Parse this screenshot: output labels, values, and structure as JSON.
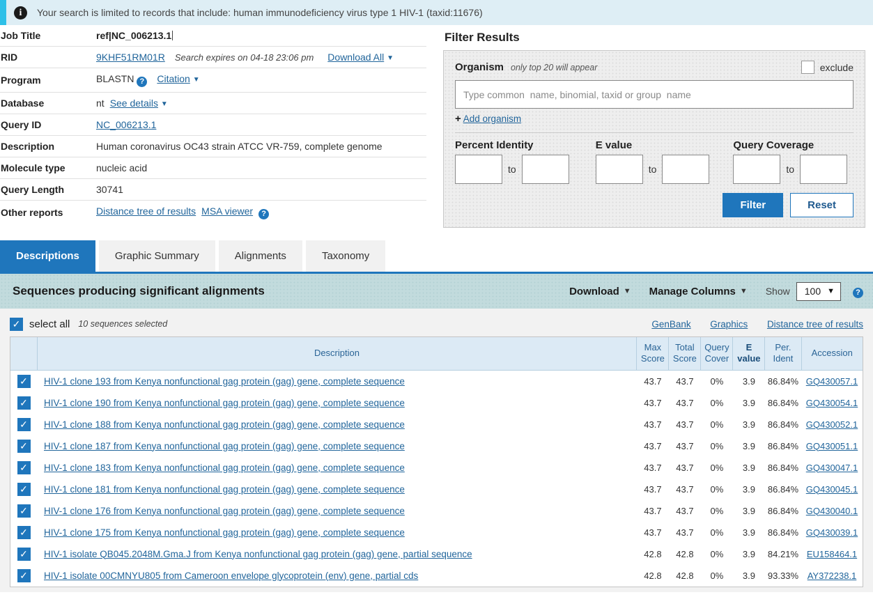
{
  "info_banner": {
    "icon": "info-icon",
    "text": "Your search is limited to records that include: human immunodeficiency virus type 1 HIV-1 (taxid:11676)"
  },
  "summary": {
    "rows": [
      {
        "label": "Job Title",
        "value": "ref|NC_006213.1"
      },
      {
        "label": "RID",
        "value": "9KHF51RM01R",
        "expires": "Search expires on 04-18 23:06 pm",
        "download_all": "Download All"
      },
      {
        "label": "Program",
        "value": "BLASTN",
        "citation": "Citation"
      },
      {
        "label": "Database",
        "value": "nt",
        "see_details": "See details"
      },
      {
        "label": "Query ID",
        "value": "NC_006213.1"
      },
      {
        "label": "Description",
        "value": "Human coronavirus OC43 strain ATCC VR-759, complete genome"
      },
      {
        "label": "Molecule type",
        "value": "nucleic acid"
      },
      {
        "label": "Query Length",
        "value": "30741"
      },
      {
        "label": "Other reports",
        "link1": "Distance tree of results",
        "link2": "MSA viewer"
      }
    ]
  },
  "filter": {
    "title": "Filter Results",
    "organism_label": "Organism",
    "organism_note": "only top 20 will appear",
    "exclude_label": "exclude",
    "organism_placeholder": "Type common  name, binomial, taxid or group  name",
    "organism_value": "",
    "add_organism": "Add organism",
    "percent_identity_label": "Percent Identity",
    "evalue_label": "E value",
    "query_coverage_label": "Query Coverage",
    "to_label": "to",
    "pct_from": "",
    "pct_to": "",
    "eval_from": "",
    "eval_to": "",
    "cov_from": "",
    "cov_to": "",
    "filter_button": "Filter",
    "reset_button": "Reset"
  },
  "tabs": [
    {
      "label": "Descriptions",
      "active": true
    },
    {
      "label": "Graphic Summary",
      "active": false
    },
    {
      "label": "Alignments",
      "active": false
    },
    {
      "label": "Taxonomy",
      "active": false
    }
  ],
  "results_band": {
    "title": "Sequences producing significant alignments",
    "download_label": "Download",
    "manage_columns_label": "Manage Columns",
    "show_label": "Show",
    "show_value": "100"
  },
  "select_all": {
    "label": "select all",
    "count_text": "10 sequences selected",
    "links": [
      "GenBank",
      "Graphics",
      "Distance tree of results"
    ]
  },
  "table": {
    "headers": {
      "description": "Description",
      "max_score": "Max\nScore",
      "max_score_l1": "Max",
      "max_score_l2": "Score",
      "total_score_l1": "Total",
      "total_score_l2": "Score",
      "query_cover_l1": "Query",
      "query_cover_l2": "Cover",
      "evalue_l1": "E",
      "evalue_l2": "value",
      "per_ident_l1": "Per.",
      "per_ident_l2": "Ident",
      "accession": "Accession"
    },
    "rows": [
      {
        "checked": true,
        "description": "HIV-1 clone 193 from Kenya nonfunctional gag protein (gag) gene, complete sequence",
        "max_score": "43.7",
        "total_score": "43.7",
        "query_cover": "0%",
        "evalue": "3.9",
        "per_ident": "86.84%",
        "accession": "GQ430057.1"
      },
      {
        "checked": true,
        "description": "HIV-1 clone 190 from Kenya nonfunctional gag protein (gag) gene, complete sequence",
        "max_score": "43.7",
        "total_score": "43.7",
        "query_cover": "0%",
        "evalue": "3.9",
        "per_ident": "86.84%",
        "accession": "GQ430054.1"
      },
      {
        "checked": true,
        "description": "HIV-1 clone 188 from Kenya nonfunctional gag protein (gag) gene, complete sequence",
        "max_score": "43.7",
        "total_score": "43.7",
        "query_cover": "0%",
        "evalue": "3.9",
        "per_ident": "86.84%",
        "accession": "GQ430052.1"
      },
      {
        "checked": true,
        "description": "HIV-1 clone 187 from Kenya nonfunctional gag protein (gag) gene, complete sequence",
        "max_score": "43.7",
        "total_score": "43.7",
        "query_cover": "0%",
        "evalue": "3.9",
        "per_ident": "86.84%",
        "accession": "GQ430051.1"
      },
      {
        "checked": true,
        "description": "HIV-1 clone 183 from Kenya nonfunctional gag protein (gag) gene, complete sequence",
        "max_score": "43.7",
        "total_score": "43.7",
        "query_cover": "0%",
        "evalue": "3.9",
        "per_ident": "86.84%",
        "accession": "GQ430047.1"
      },
      {
        "checked": true,
        "description": "HIV-1 clone 181 from Kenya nonfunctional gag protein (gag) gene, complete sequence",
        "max_score": "43.7",
        "total_score": "43.7",
        "query_cover": "0%",
        "evalue": "3.9",
        "per_ident": "86.84%",
        "accession": "GQ430045.1"
      },
      {
        "checked": true,
        "description": "HIV-1 clone 176 from Kenya nonfunctional gag protein (gag) gene, complete sequence",
        "max_score": "43.7",
        "total_score": "43.7",
        "query_cover": "0%",
        "evalue": "3.9",
        "per_ident": "86.84%",
        "accession": "GQ430040.1"
      },
      {
        "checked": true,
        "description": "HIV-1 clone 175 from Kenya nonfunctional gag protein (gag) gene, complete sequence",
        "max_score": "43.7",
        "total_score": "43.7",
        "query_cover": "0%",
        "evalue": "3.9",
        "per_ident": "86.84%",
        "accession": "GQ430039.1"
      },
      {
        "checked": true,
        "description": "HIV-1 isolate QB045.2048M.Gma.J from Kenya nonfunctional gag protein (gag) gene, partial sequence",
        "max_score": "42.8",
        "total_score": "42.8",
        "query_cover": "0%",
        "evalue": "3.9",
        "per_ident": "84.21%",
        "accession": "EU158464.1"
      },
      {
        "checked": true,
        "description": "HIV-1 isolate 00CMNYU805 from Cameroon envelope glycoprotein (env) gene, partial cds",
        "max_score": "42.8",
        "total_score": "42.8",
        "query_cover": "0%",
        "evalue": "3.9",
        "per_ident": "93.33%",
        "accession": "AY372238.1"
      }
    ]
  },
  "colors": {
    "accent": "#1f76bc",
    "banner_bg": "#deeef5",
    "banner_stripe": "#2ec0e8",
    "band_bg": "#c2dbdd",
    "link": "#21659b",
    "table_header_bg": "#dceaf5"
  }
}
